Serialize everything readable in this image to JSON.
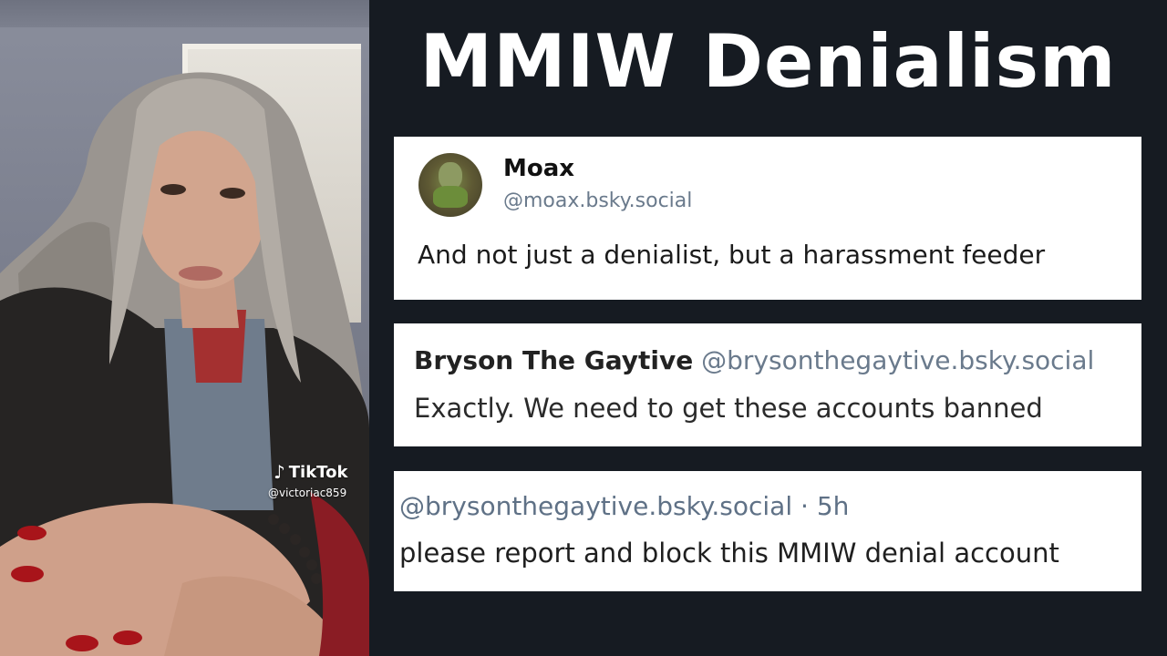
{
  "title": "MMIW Denialism",
  "video": {
    "watermark_brand": "TikTok",
    "watermark_handle": "@victoriac859",
    "icon": "tiktok-note-icon"
  },
  "posts": [
    {
      "name": "Moax",
      "handle": "@moax.bsky.social",
      "text": "And not just a denialist, but a harassment feeder"
    },
    {
      "name": "Bryson The Gaytive",
      "handle": "@brysonthegaytive.bsky.social",
      "text": "Exactly. We need to get these accounts banned"
    },
    {
      "meta": "@brysonthegaytive.bsky.social · 5h",
      "text": "please report and block this MMIW denial account"
    }
  ],
  "colors": {
    "background": "#161b22",
    "card": "#ffffff",
    "handle": "#6a7a8c"
  }
}
